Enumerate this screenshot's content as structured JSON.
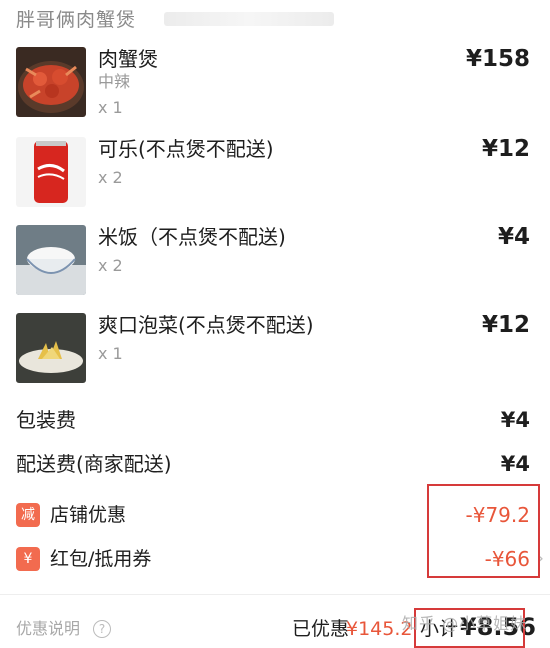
{
  "shop": {
    "name": "胖哥俩肉蟹煲"
  },
  "items": [
    {
      "name": "肉蟹煲",
      "spec": "中辣",
      "qty": "x 1",
      "price": "¥158",
      "image": "crab-pot-photo"
    },
    {
      "name": "可乐(不点煲不配送)",
      "spec": "",
      "qty": "x 2",
      "price": "¥12",
      "image": "cola-can-photo"
    },
    {
      "name": "米饭（不点煲不配送)",
      "spec": "",
      "qty": "x 2",
      "price": "¥4",
      "image": "rice-bowl-photo"
    },
    {
      "name": "爽口泡菜(不点煲不配送)",
      "spec": "",
      "qty": "x 1",
      "price": "¥12",
      "image": "pickles-photo"
    }
  ],
  "fees": {
    "packaging": {
      "label": "包装费",
      "value": "¥4"
    },
    "delivery": {
      "label": "配送费(商家配送)",
      "value": "¥4"
    }
  },
  "discounts": {
    "store": {
      "badge": "减",
      "label": "店铺优惠",
      "value": "-¥79.2"
    },
    "redpacket": {
      "badge": "¥",
      "label": "红包/抵用券",
      "value": "-¥66",
      "chevron": "›"
    }
  },
  "footer": {
    "note": "优惠说明",
    "help_icon": "?",
    "saved_label": "已优惠",
    "saved_value": "¥145.2",
    "subtotal_label": "小计",
    "subtotal_value": "¥8.56",
    "watermark": "知乎 @小草姐妹"
  },
  "colors": {
    "accent": "#e8563a",
    "badge": "#f26b4f",
    "highlight": "#d63a3a",
    "muted": "#9a9a9a"
  }
}
